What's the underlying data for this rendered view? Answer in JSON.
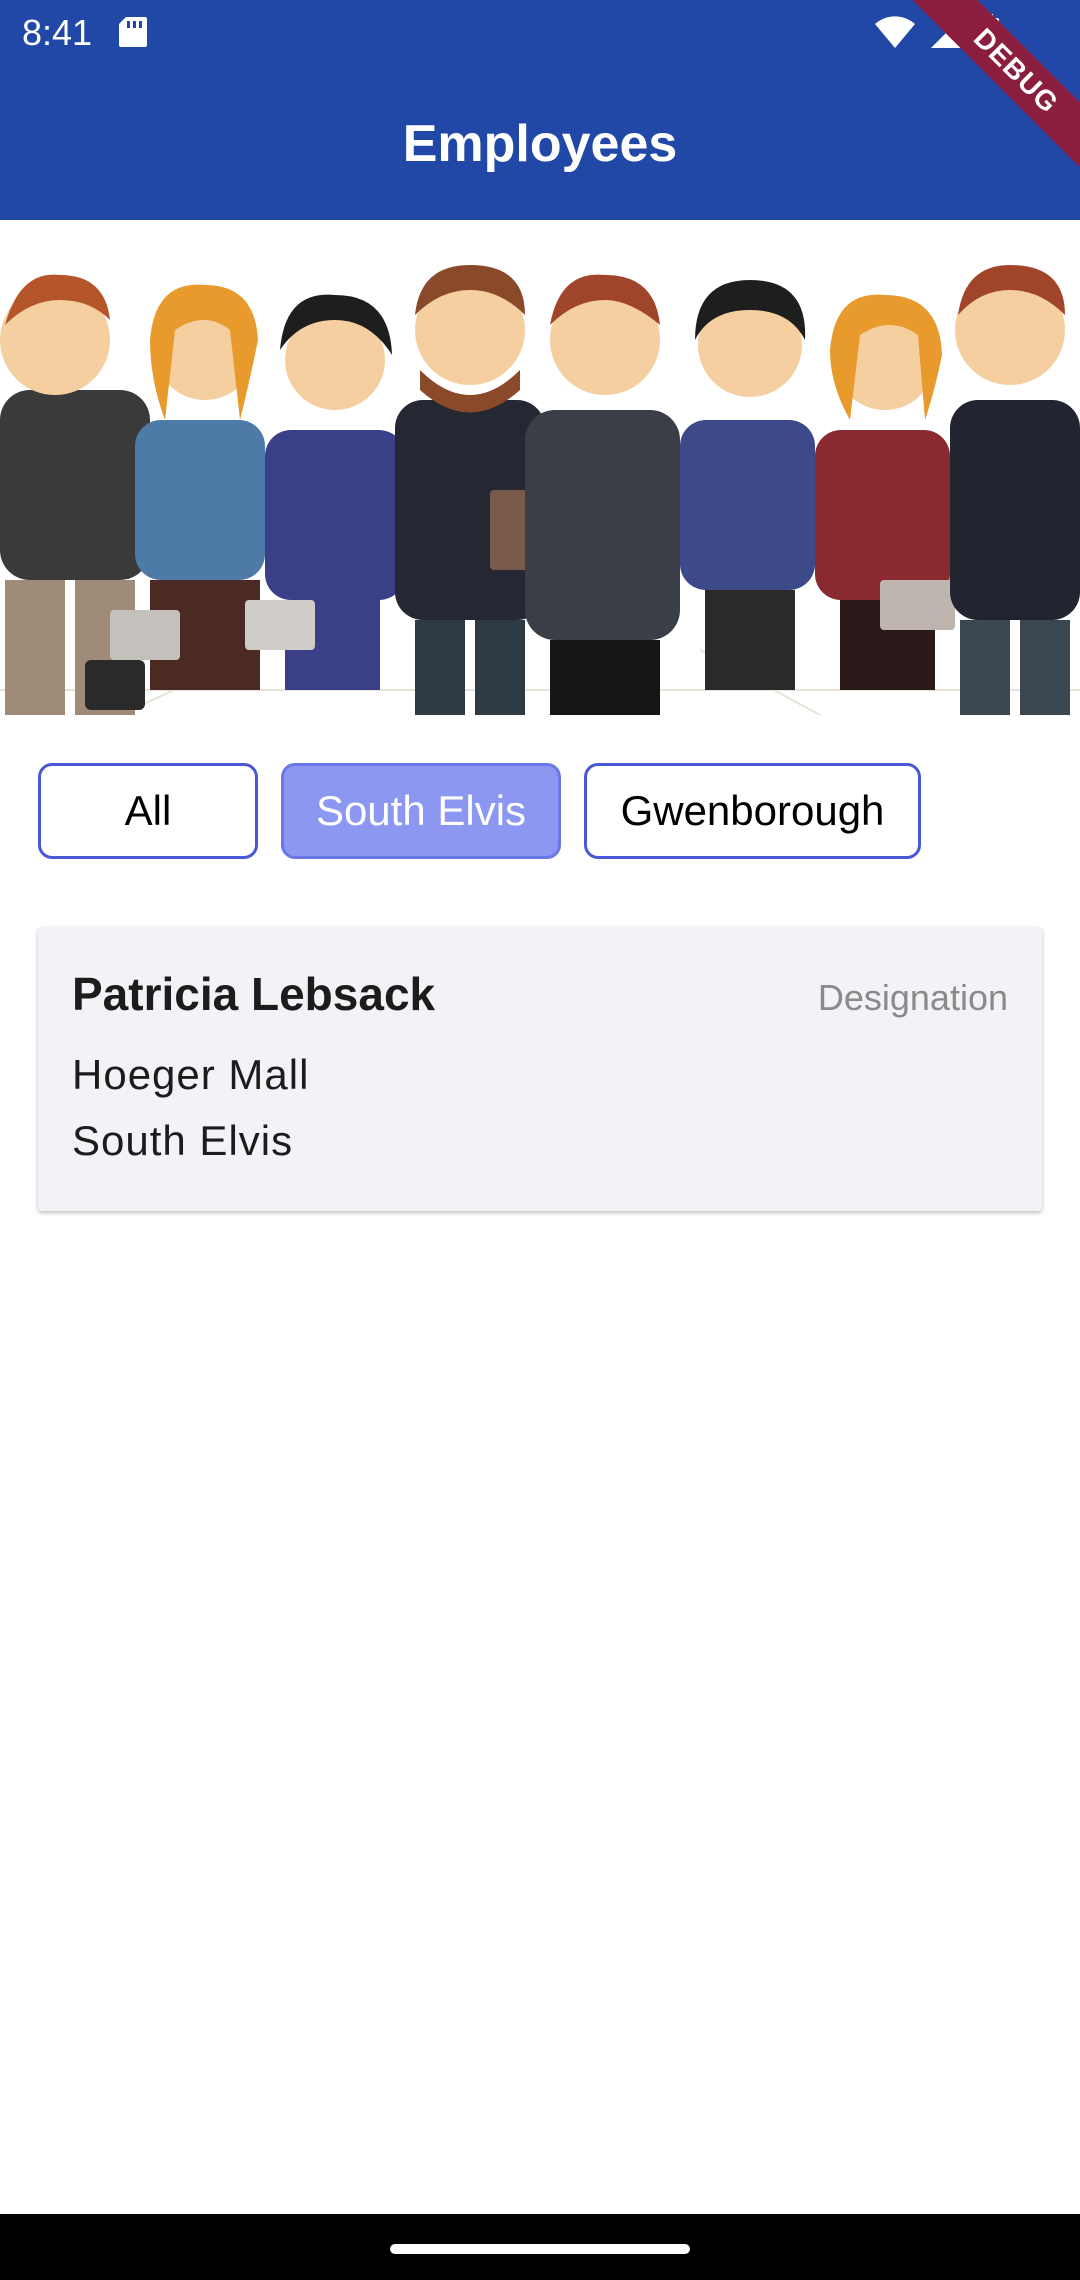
{
  "status_bar": {
    "time": "8:41",
    "icons": [
      "sd-card-icon",
      "wifi-icon",
      "signal-icon",
      "battery-icon"
    ]
  },
  "app_bar": {
    "title": "Employees",
    "color": "#2148A6"
  },
  "debug_banner": {
    "label": "DEBUG"
  },
  "hero": {
    "image": "employees-group-illustration"
  },
  "filters": {
    "options": [
      {
        "label": "All",
        "selected": false
      },
      {
        "label": "South Elvis",
        "selected": true
      },
      {
        "label": "Gwenborough",
        "selected": false
      }
    ],
    "selected_color": "#8C97F2",
    "border_color": "#4A57D6"
  },
  "employees": [
    {
      "name": "Patricia Lebsack",
      "designation": "Designation",
      "street": "Hoeger Mall",
      "city": "South Elvis"
    }
  ]
}
